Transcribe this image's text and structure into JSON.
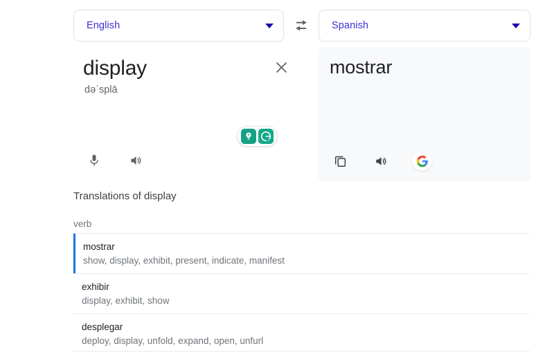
{
  "language_bar": {
    "source": {
      "label": "English",
      "icon": "chevron-down-icon"
    },
    "swap": {
      "icon": "swap-horizontal-icon"
    },
    "target": {
      "label": "Spanish",
      "icon": "chevron-down-icon"
    }
  },
  "source_panel": {
    "word": "display",
    "phonetic": "dəˈsplā",
    "clear_icon": "close-icon",
    "grammarly_badge": {
      "bulb_icon": "lightbulb-icon",
      "logo_icon": "grammarly-logo-icon"
    },
    "actions": [
      {
        "name": "microphone-button",
        "icon": "microphone-icon"
      },
      {
        "name": "listen-button",
        "icon": "speaker-icon"
      }
    ]
  },
  "result_panel": {
    "word": "mostrar",
    "actions": [
      {
        "name": "copy-button",
        "icon": "copy-icon"
      },
      {
        "name": "listen-button",
        "icon": "speaker-icon"
      },
      {
        "name": "google-search-button",
        "icon": "google-logo-icon"
      }
    ]
  },
  "translations": {
    "title": "Translations of display",
    "part_of_speech": "verb",
    "items": [
      {
        "word": "mostrar",
        "synonyms": "show, display, exhibit, present, indicate, manifest",
        "primary": true
      },
      {
        "word": "exhibir",
        "synonyms": "display, exhibit, show",
        "primary": false
      },
      {
        "word": "desplegar",
        "synonyms": "deploy, display, unfold, expand, open, unfurl",
        "primary": false
      }
    ]
  },
  "colors": {
    "link_blue": "#3b2fd6",
    "accent_blue": "#1a73e8",
    "grammarly_green": "#15a88a",
    "result_bg": "#f8f9fb",
    "text_primary": "#202124",
    "text_secondary": "#70757a"
  }
}
